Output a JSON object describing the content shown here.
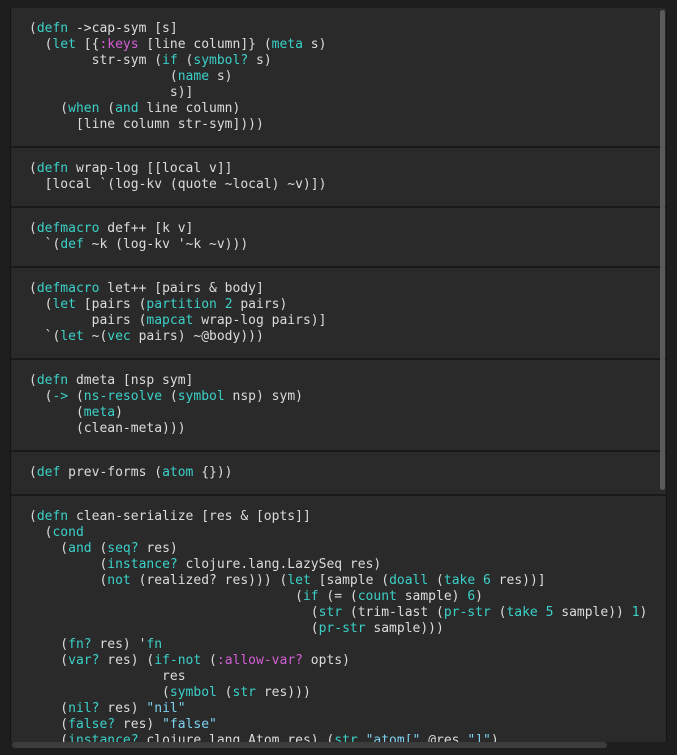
{
  "editor": {
    "cells": [
      [
        [
          [
            "(",
            "default"
          ],
          [
            "defn",
            "keyword"
          ],
          [
            " ->cap-sym [s]",
            "default"
          ]
        ],
        [
          [
            "  (",
            "default"
          ],
          [
            "let",
            "keyword"
          ],
          [
            " [{",
            "default"
          ],
          [
            ":keys",
            "keywordlit"
          ],
          [
            " [line column]} (",
            "default"
          ],
          [
            "meta",
            "keyword"
          ],
          [
            " s)",
            "default"
          ]
        ],
        [
          [
            "        str-sym (",
            "default"
          ],
          [
            "if",
            "keyword"
          ],
          [
            " (",
            "default"
          ],
          [
            "symbol?",
            "keyword"
          ],
          [
            " s)",
            "default"
          ]
        ],
        [
          [
            "                  (",
            "default"
          ],
          [
            "name",
            "keyword"
          ],
          [
            " s)",
            "default"
          ]
        ],
        [
          [
            "                  s)]",
            "default"
          ]
        ],
        [
          [
            "    (",
            "default"
          ],
          [
            "when",
            "keyword"
          ],
          [
            " (",
            "default"
          ],
          [
            "and",
            "keyword"
          ],
          [
            " line column)",
            "default"
          ]
        ],
        [
          [
            "      [line column str-sym])))",
            "default"
          ]
        ]
      ],
      [
        [
          [
            "(",
            "default"
          ],
          [
            "defn",
            "keyword"
          ],
          [
            " wrap-log [[local v]]",
            "default"
          ]
        ],
        [
          [
            "  [local `(log-kv (quote ~local) ~v)])",
            "default"
          ]
        ]
      ],
      [
        [
          [
            "(",
            "default"
          ],
          [
            "defmacro",
            "keyword"
          ],
          [
            " def++ [k v]",
            "default"
          ]
        ],
        [
          [
            "  `(",
            "default"
          ],
          [
            "def",
            "keyword"
          ],
          [
            " ~k (log-kv '~k ~v)))",
            "default"
          ]
        ]
      ],
      [
        [
          [
            "(",
            "default"
          ],
          [
            "defmacro",
            "keyword"
          ],
          [
            " let++ [pairs & body]",
            "default"
          ]
        ],
        [
          [
            "  (",
            "default"
          ],
          [
            "let",
            "keyword"
          ],
          [
            " [pairs (",
            "default"
          ],
          [
            "partition",
            "keyword"
          ],
          [
            " ",
            "default"
          ],
          [
            "2",
            "number"
          ],
          [
            " pairs)",
            "default"
          ]
        ],
        [
          [
            "        pairs (",
            "default"
          ],
          [
            "mapcat",
            "keyword"
          ],
          [
            " wrap-log pairs)]",
            "default"
          ]
        ],
        [
          [
            "  `(",
            "default"
          ],
          [
            "let",
            "keyword"
          ],
          [
            " ~(",
            "default"
          ],
          [
            "vec",
            "keyword"
          ],
          [
            " pairs) ~@body)))",
            "default"
          ]
        ]
      ],
      [
        [
          [
            "(",
            "default"
          ],
          [
            "defn",
            "keyword"
          ],
          [
            " dmeta [nsp sym]",
            "default"
          ]
        ],
        [
          [
            "  (",
            "default"
          ],
          [
            "->",
            "keyword"
          ],
          [
            " (",
            "default"
          ],
          [
            "ns-resolve",
            "keyword"
          ],
          [
            " (",
            "default"
          ],
          [
            "symbol",
            "keyword"
          ],
          [
            " nsp) sym)",
            "default"
          ]
        ],
        [
          [
            "      (",
            "default"
          ],
          [
            "meta",
            "keyword"
          ],
          [
            ")",
            "default"
          ]
        ],
        [
          [
            "      (clean-meta)))",
            "default"
          ]
        ]
      ],
      [
        [
          [
            "(",
            "default"
          ],
          [
            "def",
            "keyword"
          ],
          [
            " prev-forms (",
            "default"
          ],
          [
            "atom",
            "keyword"
          ],
          [
            " {}))",
            "default"
          ]
        ]
      ],
      [
        [
          [
            "(",
            "default"
          ],
          [
            "defn",
            "keyword"
          ],
          [
            " clean-serialize [res & [opts]]",
            "default"
          ]
        ],
        [
          [
            "  (",
            "default"
          ],
          [
            "cond",
            "keyword"
          ]
        ],
        [
          [
            "    (",
            "default"
          ],
          [
            "and",
            "keyword"
          ],
          [
            " (",
            "default"
          ],
          [
            "seq?",
            "keyword"
          ],
          [
            " res)",
            "default"
          ]
        ],
        [
          [
            "         (",
            "default"
          ],
          [
            "instance?",
            "keyword"
          ],
          [
            " clojure.lang.LazySeq res)",
            "default"
          ]
        ],
        [
          [
            "         (",
            "default"
          ],
          [
            "not",
            "keyword"
          ],
          [
            " (realized? res))) (",
            "default"
          ],
          [
            "let",
            "keyword"
          ],
          [
            " [sample (",
            "default"
          ],
          [
            "doall",
            "keyword"
          ],
          [
            " (",
            "default"
          ],
          [
            "take",
            "keyword"
          ],
          [
            " ",
            "default"
          ],
          [
            "6",
            "number"
          ],
          [
            " res))]",
            "default"
          ]
        ],
        [
          [
            "                                  (",
            "default"
          ],
          [
            "if",
            "keyword"
          ],
          [
            " (= (",
            "default"
          ],
          [
            "count",
            "keyword"
          ],
          [
            " sample) ",
            "default"
          ],
          [
            "6",
            "number"
          ],
          [
            ")",
            "default"
          ]
        ],
        [
          [
            "                                    (",
            "default"
          ],
          [
            "str",
            "keyword"
          ],
          [
            " (trim-last (",
            "default"
          ],
          [
            "pr-str",
            "keyword"
          ],
          [
            " (",
            "default"
          ],
          [
            "take",
            "keyword"
          ],
          [
            " ",
            "default"
          ],
          [
            "5",
            "number"
          ],
          [
            " sample)) ",
            "default"
          ],
          [
            "1",
            "number"
          ],
          [
            ")",
            "default"
          ]
        ],
        [
          [
            "                                    (",
            "default"
          ],
          [
            "pr-str",
            "keyword"
          ],
          [
            " sample)))",
            "default"
          ]
        ],
        [
          [
            "    (",
            "default"
          ],
          [
            "fn?",
            "keyword"
          ],
          [
            " res) '",
            "default"
          ],
          [
            "fn",
            "keyword"
          ]
        ],
        [
          [
            "    (",
            "default"
          ],
          [
            "var?",
            "keyword"
          ],
          [
            " res) (",
            "default"
          ],
          [
            "if-not",
            "keyword"
          ],
          [
            " (",
            "default"
          ],
          [
            ":allow-var?",
            "keywordlit"
          ],
          [
            " opts)",
            "default"
          ]
        ],
        [
          [
            "                 res",
            "default"
          ]
        ],
        [
          [
            "                 (",
            "default"
          ],
          [
            "symbol",
            "keyword"
          ],
          [
            " (",
            "default"
          ],
          [
            "str",
            "keyword"
          ],
          [
            " res)))",
            "default"
          ]
        ],
        [
          [
            "    (",
            "default"
          ],
          [
            "nil?",
            "keyword"
          ],
          [
            " res) ",
            "default"
          ],
          [
            "\"nil\"",
            "string"
          ]
        ],
        [
          [
            "    (",
            "default"
          ],
          [
            "false?",
            "keyword"
          ],
          [
            " res) ",
            "default"
          ],
          [
            "\"false\"",
            "string"
          ]
        ],
        [
          [
            "    (",
            "default"
          ],
          [
            "instance?",
            "keyword"
          ],
          [
            " clojure.lang.Atom res) (",
            "default"
          ],
          [
            "str",
            "keyword"
          ],
          [
            " ",
            "default"
          ],
          [
            "\"atom[\"",
            "string"
          ],
          [
            " @res ",
            "default"
          ],
          [
            "\"]\"",
            "string"
          ],
          [
            ")",
            "default"
          ]
        ]
      ]
    ]
  },
  "colors": {
    "background": "#2a2a2a",
    "keyword": "#3bd1c8",
    "keyword_literal": "#d45fd6",
    "string": "#7dd3f0",
    "text": "#dcdcdc"
  }
}
